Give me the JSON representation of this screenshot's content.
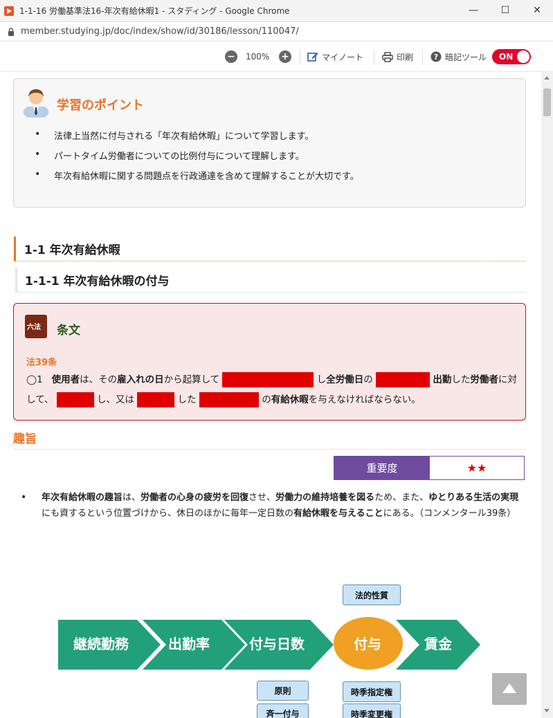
{
  "window": {
    "title": "1-1-16 労働基準法16-年次有給休暇1 - スタディング - Google Chrome",
    "controls": {
      "minimize": "—",
      "maximize": "☐",
      "close": "✕"
    }
  },
  "address_bar": {
    "url": "member.studying.jp/doc/index/show/id/30186/lesson/110047/"
  },
  "toolbar": {
    "zoom_out": "−",
    "zoom_level": "100%",
    "zoom_in": "+",
    "my_note": "マイノート",
    "print": "印刷",
    "memo_tool": "暗記ツール",
    "toggle_state": "ON"
  },
  "point": {
    "title": "学習のポイント",
    "items": [
      "法律上当然に付与される「年次有給休暇」について学習します。",
      "パートタイム労働者についての比例付与について理解します。",
      "年次有給休暇に関する問題点を行政通達を含めて理解することが大切です。"
    ]
  },
  "headings": {
    "h1": "1-1 年次有給休暇",
    "h2": "1-1-1 年次有給休暇の付与"
  },
  "law": {
    "icon_text": "六法",
    "title": "条文",
    "ref": "法39条",
    "para_num": "◯1",
    "seg": {
      "s1": "使用者",
      "s2": "は、その",
      "s3": "雇入れの日",
      "s4": "から起算して",
      "s5": "し",
      "s6": "全労働日",
      "s7": "の",
      "s8": "出勤",
      "s9": "した",
      "s10": "労働者",
      "s11": "に対して、",
      "s12": "し、又は",
      "s13": "した",
      "s14": "の",
      "s15": "有給休暇",
      "s16": "を与えなければならない。"
    }
  },
  "purpose": {
    "heading": "趣旨",
    "importance_label": "重要度",
    "importance_value": "★★",
    "importance_stars": 2,
    "seg": {
      "p1": "年次有給休暇の趣旨",
      "p2": "は、",
      "p3": "労働者の心身の疲労を回復",
      "p4": "させ、",
      "p5": "労働力の維持培養を図る",
      "p6": "ため、また、",
      "p7": "ゆとりある生活の実現",
      "p8": "にも資するという位置づけから、休日のほかに毎年一定日数の",
      "p9": "有給休暇を与えること",
      "p10": "にある。（コンメンタール39条）"
    }
  },
  "flow": {
    "steps": [
      "継続勤務",
      "出勤率",
      "付与日数",
      "付与",
      "賃金"
    ],
    "tags": {
      "legal_nature": "法的性質",
      "principle": "原則",
      "uniform_grant": "斉一付与",
      "designation_right": "時季指定権",
      "change_right": "時季変更権"
    },
    "colors": {
      "arrow": "#21a07a",
      "circle": "#f0a022",
      "tag_bg": "#c9e3f7"
    }
  },
  "back_to_top": "▲"
}
